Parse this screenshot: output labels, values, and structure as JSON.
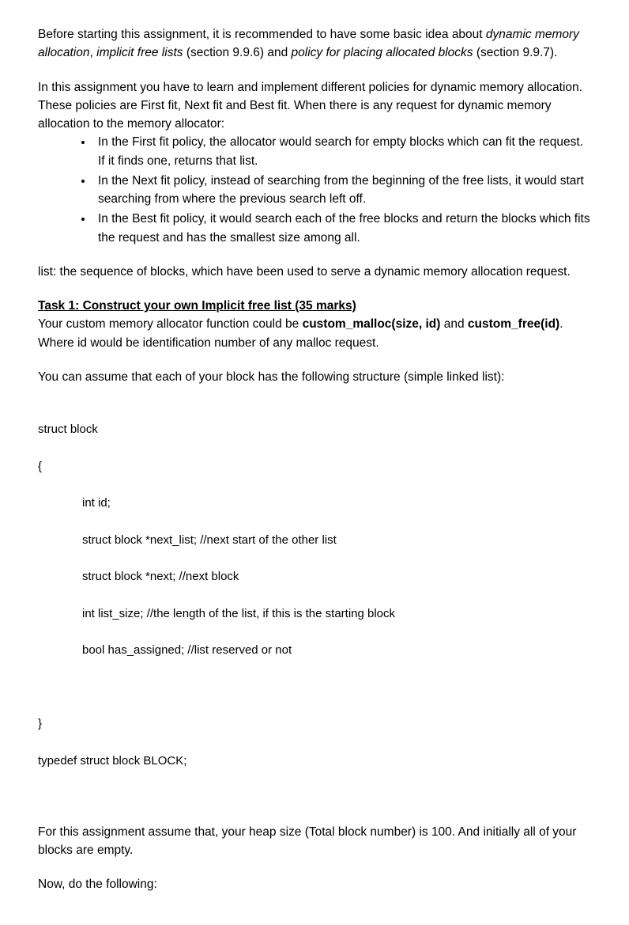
{
  "intro": {
    "p1_a": "Before starting this assignment, it is recommended to have some basic idea about ",
    "p1_i1": "dynamic memory allocation",
    "p1_b": ",  ",
    "p1_i2": "implicit free lists",
    "p1_c": " (section 9.9.6) and ",
    "p1_i3": "policy for placing allocated blocks",
    "p1_d": " (section 9.9.7).",
    "p2": "In this assignment you have to learn and implement different policies for dynamic memory allocation. These policies are First fit, Next fit and Best fit. When there is any request for dynamic memory allocation to the memory allocator:"
  },
  "bullets": {
    "b1": "In the First fit policy, the allocator would search for empty blocks which can fit the request. If it finds one, returns that list.",
    "b2": "In the Next fit policy, instead of searching from the beginning of the free lists, it would start searching from where the previous search left off.",
    "b3": "In the Best fit policy, it would search each of the free blocks and return the blocks which fits the request and has the smallest size among all."
  },
  "list_def": "list: the sequence of blocks, which have been used to serve a dynamic memory allocation request.",
  "task1": {
    "heading": "Task 1: Construct your own Implicit free list (35 marks)",
    "p1_a": "Your custom memory allocator function could be ",
    "p1_b1": "custom_malloc(size, id)",
    "p1_b": " and ",
    "p1_b2": "custom_free(id)",
    "p1_c": ". Where id would be identification number of any malloc request.",
    "p2": "You can assume that each of your block has the following structure (simple linked list):"
  },
  "code": {
    "l1": "struct block",
    "l2": "{",
    "l3": "int id;",
    "l4": "struct block *next_list; //next start of the other list",
    "l5": "struct block *next; //next block",
    "l6": "int list_size; //the length of the list, if this is the starting block",
    "l7": "bool has_assigned; //list reserved or not",
    "l8": "}",
    "l9": "typedef struct block BLOCK;"
  },
  "after_code": {
    "p1": "For this assignment assume that, your heap size (Total block number) is 100. And initially all of your blocks are empty.",
    "p2": "Now, do the following:"
  }
}
